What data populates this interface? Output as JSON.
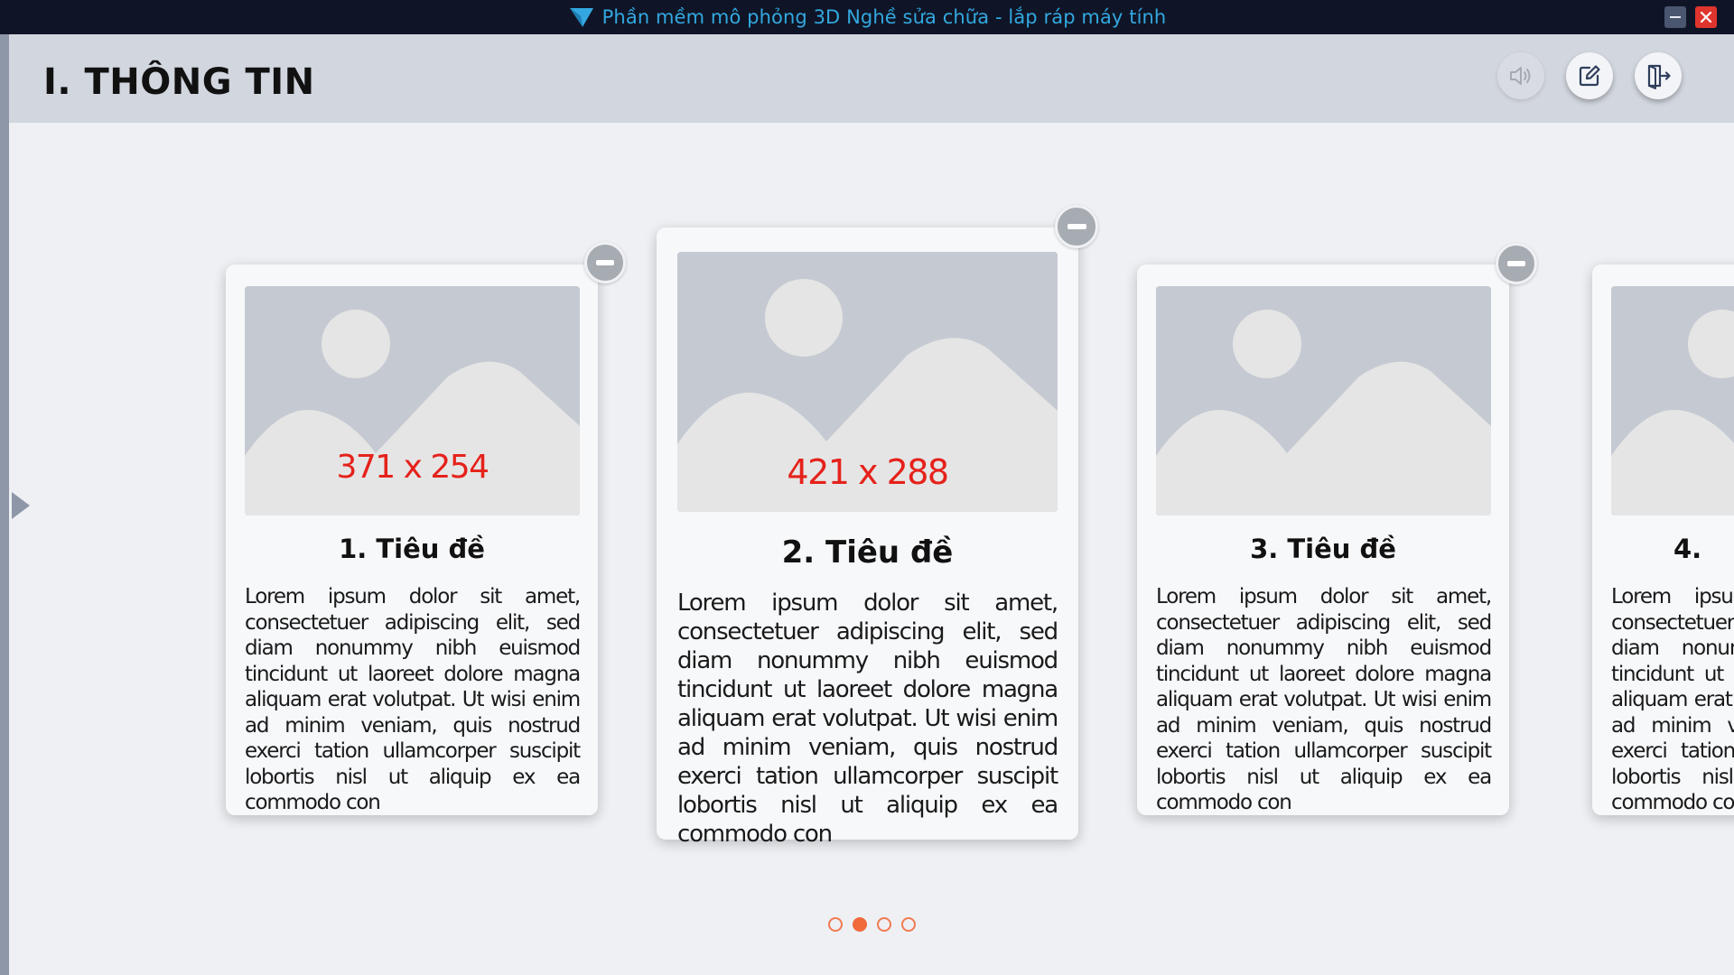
{
  "window": {
    "title": "Phần mềm mô phỏng 3D Nghề sửa chữa - lắp ráp máy tính"
  },
  "header": {
    "title": "I. THÔNG TIN"
  },
  "cards": [
    {
      "title": "1. Tiêu đề",
      "image_label": "371 x 254",
      "text": "Lorem ipsum dolor sit amet, consectetuer adipiscing elit, sed diam nonummy nibh euismod tincidunt ut laoreet dolore magna aliquam erat volutpat. Ut wisi enim ad minim veniam, quis nostrud exerci tation ullamcorper suscipit lobortis nisl ut aliquip ex ea commodo con"
    },
    {
      "title": "2. Tiêu đề",
      "image_label": "421 x 288",
      "text": "Lorem ipsum dolor sit amet, consectetuer adipiscing elit, sed diam nonummy nibh euismod tincidunt ut laoreet dolore magna aliquam erat volutpat. Ut wisi enim ad minim veniam, quis nostrud exerci tation ullamcorper suscipit lobortis nisl ut aliquip ex ea commodo con"
    },
    {
      "title": "3. Tiêu đề",
      "image_label": "",
      "text": "Lorem ipsum dolor sit amet, consectetuer adipiscing elit, sed diam nonummy nibh euismod tincidunt ut laoreet dolore magna aliquam erat volutpat. Ut wisi enim ad minim veniam, quis nostrud exerci tation ullamcorper suscipit lobortis nisl ut aliquip ex ea commodo con"
    },
    {
      "title": "4.",
      "image_label": "",
      "text": "Lorem ipsum dolor sit amet, consectetuer adipiscing elit, sed diam nonummy nibh euismod tincidunt ut laoreet dolore magna aliquam erat volutpat. Ut wisi enim ad minim veniam, quis nostrud exerci tation ullamcorper suscipit lobortis nisl ut aliquip ex ea commodo con"
    }
  ],
  "pagination": {
    "total": 4,
    "active_index": 1
  },
  "icons": {
    "app_logo": "arrow-logo-icon",
    "sound": "speaker-icon",
    "edit": "edit-icon",
    "exit": "exit-door-icon",
    "remove": "minus-icon",
    "prev": "triangle-left-arrow-icon",
    "placeholder_image": "image-placeholder-icon"
  },
  "colors": {
    "titlebar_bg": "#0f1526",
    "title_text": "#33a8e0",
    "header_bg": "#d2d6de",
    "content_bg": "#eef0f4",
    "accent": "#f06a3c",
    "dimension_label": "#e5221b",
    "close_button": "#e0342e"
  }
}
